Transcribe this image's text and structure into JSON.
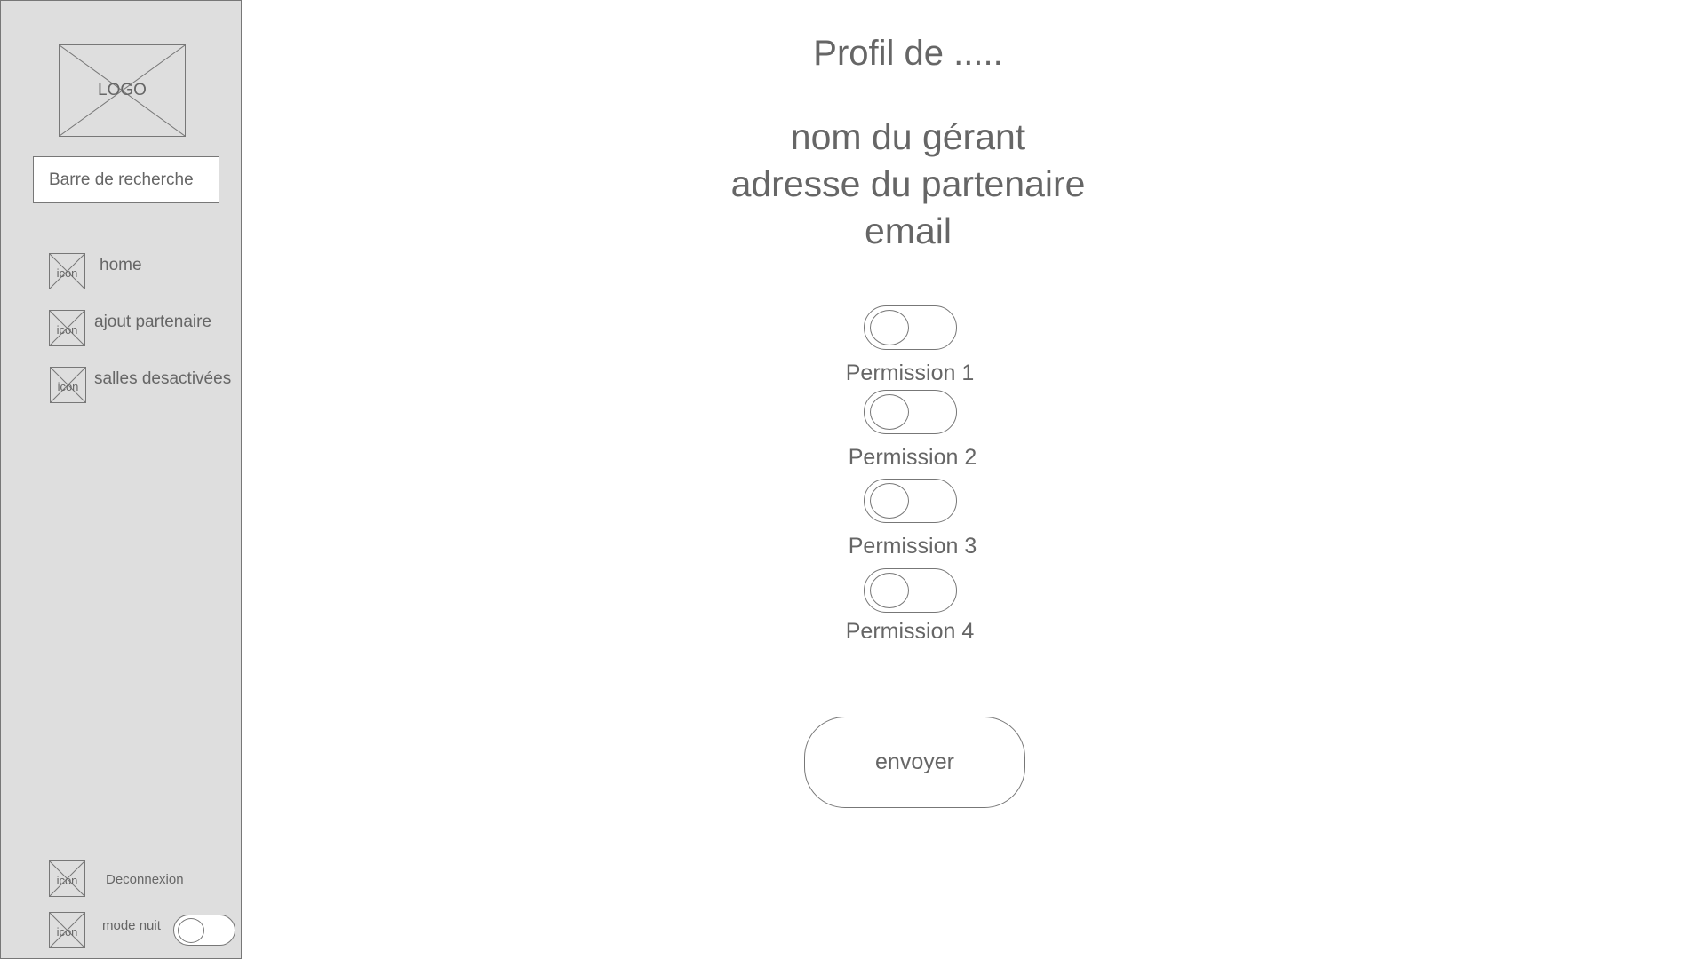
{
  "sidebar": {
    "logo_label": "LOGO",
    "search": {
      "placeholder": "Barre de recherche"
    },
    "items": [
      {
        "icon_label": "icon",
        "label": "home"
      },
      {
        "icon_label": "icon",
        "label": "ajout partenaire"
      },
      {
        "icon_label": "icon",
        "label": "salles desactivées"
      }
    ],
    "footer": {
      "logout": {
        "icon_label": "icon",
        "label": "Deconnexion"
      },
      "night_mode": {
        "icon_label": "icon",
        "label": "mode nuit",
        "enabled": false
      }
    }
  },
  "main": {
    "title": "Profil de .....",
    "info": {
      "manager_name": "nom du gérant",
      "partner_address": "adresse du partenaire",
      "email": "email"
    },
    "permissions": [
      {
        "label": "Permission 1",
        "enabled": false
      },
      {
        "label": "Permission 2",
        "enabled": false
      },
      {
        "label": "Permission 3",
        "enabled": false
      },
      {
        "label": "Permission 4",
        "enabled": false
      }
    ],
    "submit_label": "envoyer"
  },
  "colors": {
    "sidebar_bg": "#dedede",
    "stroke": "#777777",
    "text": "#666666",
    "background": "#ffffff"
  }
}
